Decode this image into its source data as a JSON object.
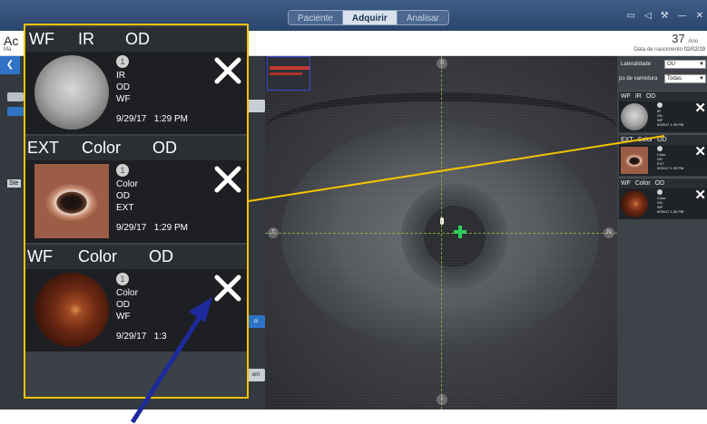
{
  "topbar": {
    "tabs": [
      {
        "label": "Paciente",
        "active": false
      },
      {
        "label": "Adquirir",
        "active": true
      },
      {
        "label": "Analisar",
        "active": false
      }
    ],
    "icons": [
      "monitor-icon",
      "speaker-icon",
      "wrench-icon",
      "minimize-icon",
      "close-icon"
    ]
  },
  "patient": {
    "name": "Ac",
    "name_sub": "Ma",
    "age": "37",
    "age_unit": "Ano",
    "dob_label": "Data de nascimento",
    "dob_value": "02/02/19"
  },
  "left_panel": {
    "ste_label": "Ste",
    "ci_label": "ci",
    "em_label": "em"
  },
  "right_panel": {
    "laterality_label": "Lateralidade",
    "laterality_value": "OU",
    "scan_type_label": "po de varredura",
    "scan_type_value": "Todas",
    "cards": [
      {
        "modality": "WF",
        "type": "IR",
        "eye": "OD",
        "lines": [
          "IR",
          "OD",
          "WF"
        ],
        "date": "9/29/17",
        "time": "1:29 PM"
      },
      {
        "modality": "EXT",
        "type": "Color",
        "eye": "OD",
        "lines": [
          "Color",
          "OD",
          "EXT"
        ],
        "date": "9/29/17",
        "time": "1:29 PM"
      },
      {
        "modality": "WF",
        "type": "Color",
        "eye": "OD",
        "lines": [
          "Color",
          "OD",
          "WF"
        ],
        "date": "9/29/17",
        "time": "1:30 PM"
      }
    ]
  },
  "callout": {
    "cards": [
      {
        "modality": "WF",
        "type": "IR",
        "eye": "OD",
        "badge": "1",
        "line1": "IR",
        "line2": "OD",
        "line3": "WF",
        "datetime": "9/29/17   1:29 PM"
      },
      {
        "modality": "EXT",
        "type": "Color",
        "eye": "OD",
        "badge": "1",
        "line1": "Color",
        "line2": "OD",
        "line3": "EXT",
        "datetime": "9/29/17   1:29 PM"
      },
      {
        "modality": "WF",
        "type": "Color",
        "eye": "OD",
        "badge": "1",
        "line1": "Color",
        "line2": "OD",
        "line3": "WF",
        "datetime": "9/29/17   1:3"
      }
    ]
  },
  "camera": {
    "marker_top": "S",
    "marker_left": "T",
    "marker_right": "N",
    "marker_bottom": "I"
  },
  "colors": {
    "callout_border": "#f3c400",
    "arrow": "#1c2a9c",
    "crosshair": "#2bd05a",
    "active_tab": "#d9e1ec"
  }
}
